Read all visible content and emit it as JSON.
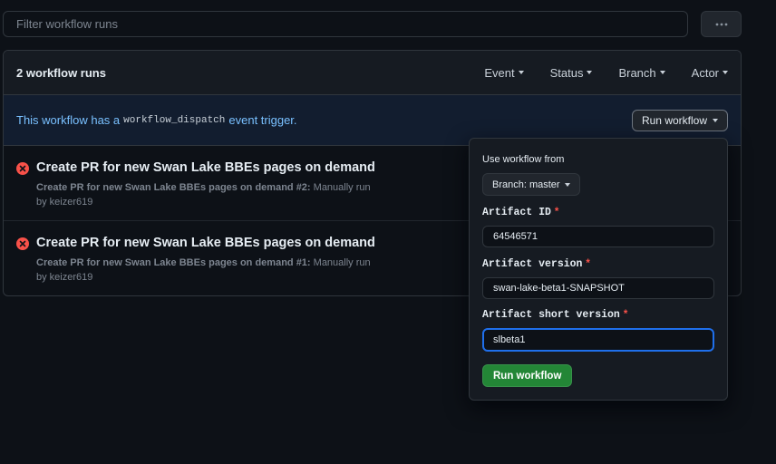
{
  "filter": {
    "placeholder": "Filter workflow runs",
    "value": ""
  },
  "runs": {
    "count_label": "2 workflow runs",
    "filters": [
      {
        "label": "Event"
      },
      {
        "label": "Status"
      },
      {
        "label": "Branch"
      },
      {
        "label": "Actor"
      }
    ],
    "banner": {
      "prefix": "This workflow has a",
      "code": "workflow_dispatch",
      "suffix": "event trigger.",
      "button_label": "Run workflow"
    },
    "items": [
      {
        "title": "Create PR for new Swan Lake BBEs pages on demand",
        "meta_bold": "Create PR for new Swan Lake BBEs pages on demand #2:",
        "meta_text": "Manually run",
        "by": "by keizer619"
      },
      {
        "title": "Create PR for new Swan Lake BBEs pages on demand",
        "meta_bold": "Create PR for new Swan Lake BBEs pages on demand #1:",
        "meta_text": "Manually run",
        "by": "by keizer619"
      }
    ]
  },
  "popover": {
    "use_from_label": "Use workflow from",
    "branch_label": "Branch: master",
    "fields": [
      {
        "label": "Artifact ID",
        "value": "64546571"
      },
      {
        "label": "Artifact version",
        "value": "swan-lake-beta1-SNAPSHOT"
      },
      {
        "label": "Artifact short version",
        "value": "slbeta1"
      }
    ],
    "required_mark": "*",
    "submit_label": "Run workflow"
  },
  "colors": {
    "accent_blue": "#1f6feb",
    "success_green": "#238636",
    "danger_red": "#f85149"
  }
}
